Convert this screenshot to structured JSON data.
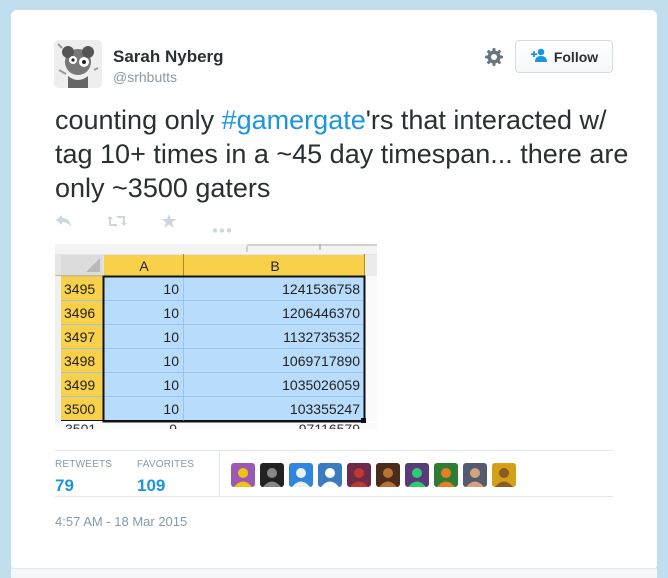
{
  "tweet": {
    "user": {
      "name": "Sarah Nyberg",
      "handle": "@srhbutts"
    },
    "follow_label": "Follow",
    "text_before": "counting only ",
    "hashtag": "#gamergate",
    "text_after": "'rs that interacted w/ tag 10+ times in a ~45 day timespan... there are only ~3500 gaters",
    "stats": {
      "retweets_label": "RETWEETS",
      "retweets_count": "79",
      "favorites_label": "FAVORITES",
      "favorites_count": "109"
    },
    "timestamp": "4:57 AM - 18 Mar 2015",
    "favoriter_avatar_count": 10
  },
  "spreadsheet": {
    "col_headers": [
      "A",
      "B"
    ],
    "rows": [
      {
        "row": "3495",
        "a": "10",
        "b": "1241536758"
      },
      {
        "row": "3496",
        "a": "10",
        "b": "1206446370"
      },
      {
        "row": "3497",
        "a": "10",
        "b": "1132735352"
      },
      {
        "row": "3498",
        "a": "10",
        "b": "1069717890"
      },
      {
        "row": "3499",
        "a": "10",
        "b": "1035026059"
      },
      {
        "row": "3500",
        "a": "10",
        "b": "103355247"
      }
    ]
  },
  "colors": {
    "link": "#1b95e0",
    "text": "#292f33",
    "muted": "#8899a6",
    "selection": "#b8dcfb",
    "header_yellow": "#f8d04a"
  }
}
